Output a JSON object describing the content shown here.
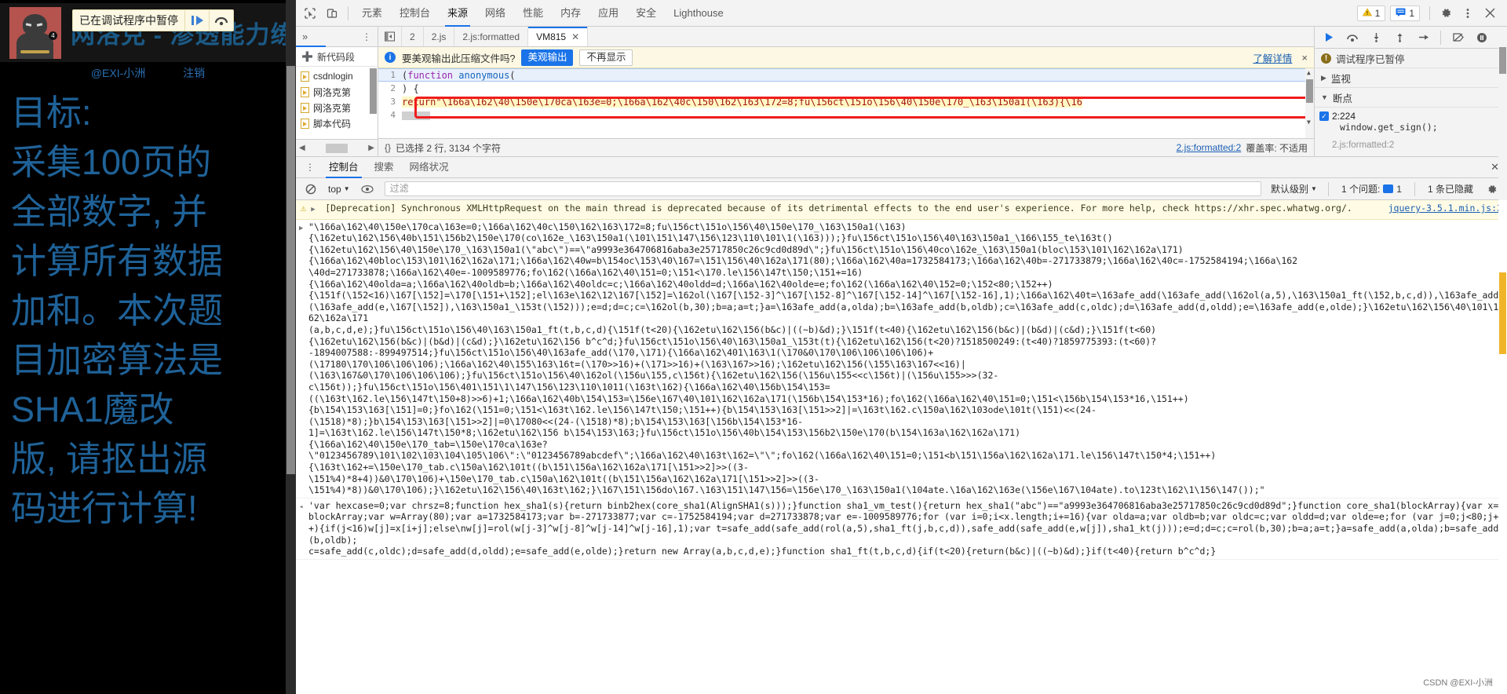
{
  "webpage": {
    "paused_banner": {
      "text": "已在调试程序中暂停",
      "resume_icon": "resume-icon",
      "step_icon": "step-over-icon"
    },
    "site_title": "网洛克 - 渗透能力练习平台",
    "avatar_badge": "4",
    "byline": "@EXI-小洲",
    "logout": "注销",
    "goal_lines": [
      "目标:",
      "采集100页的",
      "全部数字, 并",
      "计算所有数据",
      "加和。本次题",
      "目加密算法是",
      "SHA1魔改",
      "版, 请抠出源",
      "码进行计算!"
    ]
  },
  "devtools": {
    "toolbar": {
      "inspect_icon": "inspect-element-icon",
      "device_icon": "device-toolbar-icon",
      "tabs": [
        {
          "label": "元素",
          "active": false
        },
        {
          "label": "控制台",
          "active": false
        },
        {
          "label": "来源",
          "active": true
        },
        {
          "label": "网络",
          "active": false
        },
        {
          "label": "性能",
          "active": false
        },
        {
          "label": "内存",
          "active": false
        },
        {
          "label": "应用",
          "active": false
        },
        {
          "label": "安全",
          "active": false
        },
        {
          "label": "Lighthouse",
          "active": false
        }
      ],
      "warning_count": "1",
      "message_count": "1",
      "settings_icon": "gear-icon",
      "more_icon": "kebab-menu-icon",
      "close_icon": "close-icon"
    },
    "navigator": {
      "overflow_icon": "chevron-double-right-icon",
      "more_icon": "kebab-menu-icon",
      "new_snippet": "新代码段",
      "files": [
        "csdnlogin",
        "网洛克第",
        "网洛克第",
        "脚本代码"
      ]
    },
    "editor": {
      "sidebar_toggle_icon": "show-navigator-icon",
      "tabs": [
        {
          "label": "2",
          "active": false,
          "closable": false
        },
        {
          "label": "2.js",
          "active": false,
          "closable": false
        },
        {
          "label": "2.js:formatted",
          "active": false,
          "closable": false
        },
        {
          "label": "VM815",
          "active": true,
          "closable": true
        }
      ],
      "infobar": {
        "icon": "info-icon",
        "message": "要美观输出此压缩文件吗?",
        "primary_button": "美观输出",
        "secondary_button": "不再显示",
        "learn_more": "了解详情",
        "close": "×"
      },
      "code_lines": [
        {
          "num": "1",
          "text": "(function anonymous("
        },
        {
          "num": "2",
          "text": ") {"
        },
        {
          "num": "3",
          "text": "return\"\\166a\\162\\40\\150e\\170ca\\163e=0;\\166a\\162\\40c\\150\\162\\163\\172=8;fu\\156ct\\151o\\156\\40\\150e\\170_\\163\\150a1(\\163){\\16"
        },
        {
          "num": "4",
          "text": "}"
        }
      ],
      "status": {
        "braces_icon": "format-braces-icon",
        "selection": "已选择 2 行, 3134 个字符",
        "source_link": "2.js:formatted:2",
        "coverage": "覆盖率: 不适用"
      }
    },
    "debugger": {
      "controls": [
        "resume-icon",
        "step-over-icon",
        "step-into-icon",
        "step-out-icon",
        "step-icon",
        "deactivate-breakpoints-icon",
        "pause-on-exceptions-icon"
      ],
      "paused_title": "调试程序已暂停",
      "watch_label": "监视",
      "breakpoints_label": "断点",
      "breakpoints": [
        {
          "location": "2:224",
          "source": "window.get_sign();",
          "checked": true
        }
      ],
      "next_partial": "2.js:formatted:2"
    },
    "drawer": {
      "more_icon": "kebab-menu-icon",
      "tabs": [
        {
          "label": "控制台",
          "active": true
        },
        {
          "label": "搜索",
          "active": false
        },
        {
          "label": "网络状况",
          "active": false
        }
      ],
      "close_icon": "close-icon",
      "toolbar": {
        "clear_icon": "clear-console-icon",
        "context": "top",
        "eye_icon": "live-expression-icon",
        "filter_placeholder": "过滤",
        "level": "默认级别",
        "issues": "1 个问题:",
        "issue_count": "1",
        "hidden": "1 条已隐藏",
        "settings_icon": "gear-icon"
      },
      "messages": [
        {
          "type": "warning",
          "icon": "warning-triangle-icon",
          "text": "[Deprecation] Synchronous XMLHttpRequest on the main thread is deprecated because of its detrimental effects to the end user's experience. For more help, check https://xhr.spec.whatwg.org/.",
          "link": "https://xhr.spec.whatwg.org/",
          "source": "jquery-3.5.1.min.js:2"
        },
        {
          "type": "log",
          "arrow": "▶",
          "text": "\"\\166a\\162\\40\\150e\\170ca\\163e=0;\\166a\\162\\40c\\150\\162\\163\\172=8;fu\\156ct\\151o\\156\\40\\150e\\170_\\163\\150a1(\\163)\n{\\162etu\\162\\156\\40b\\151\\156b2\\150e\\170(co\\162e_\\163\\150a1(\\101\\151\\147\\156\\123\\110\\101\\1(\\163)));}fu\\156ct\\151o\\156\\40\\163\\150a1_\\166\\155_te\\163t()\n{\\162etu\\162\\156\\40\\150e\\170_\\163\\150a1(\\\"abc\\\")==\\\"a9993e364706816aba3e25717850c26c9cd0d89d\\\";}fu\\156ct\\151o\\156\\40co\\162e_\\163\\150a1(bloc\\153\\101\\162\\162a\\171)\n{\\166a\\162\\40bloc\\153\\101\\162\\162a\\171;\\166a\\162\\40w=b\\154oc\\153\\40\\167=\\151\\156\\40\\162a\\171(80);\\166a\\162\\40a=1732584173;\\166a\\162\\40b=-271733879;\\166a\\162\\40c=-1752584194;\\166a\\162\n\\40d=271733878;\\166a\\162\\40e=-1009589776;fo\\162(\\166a\\162\\40\\151=0;\\151<\\170.le\\156\\147t\\150;\\151+=16)\n{\\166a\\162\\40olda=a;\\166a\\162\\40oldb=b;\\166a\\162\\40oldc=c;\\166a\\162\\40oldd=d;\\166a\\162\\40olde=e;fo\\162(\\166a\\162\\40\\152=0;\\152<80;\\152++)\n{\\151f(\\152<16)\\167[\\152]=\\170[\\151+\\152];el\\163e\\162\\12\\167[\\152]=\\162ol(\\167[\\152-3]^\\167[\\152-8]^\\167[\\152-14]^\\167[\\152-16],1);\\166a\\162\\40t=\\163afe_add(\\163afe_add(\\162ol(a,5),\\163\\150a1_ft(\\152,b,c,d)),\\163afe_add(\\163afe_add(e,\\167[\\152]),\\163\\150a1_\\153t(\\152)));e=d;d=c;c=\\162ol(b,30);b=a;a=t;}a=\\163afe_add(a,olda);b=\\163afe_add(b,oldb);c=\\163afe_add(c,oldc);d=\\163afe_add(d,oldd);e=\\163afe_add(e,olde);}\\162etu\\162\\156\\40\\101\\162\\162a\\171\n(a,b,c,d,e);}fu\\156ct\\151o\\156\\40\\163\\150a1_ft(t,b,c,d){\\151f(t<20){\\162etu\\162\\156(b&c)|((~b)&d);}\\151f(t<40){\\162etu\\162\\156(b&c)|(b&d)|(c&d);}\\151f(t<60)\n{\\162etu\\162\\156(b&c)|(b&d)|(c&d);}\\162etu\\162\\156 b^c^d;}fu\\156ct\\151o\\156\\40\\163\\150a1_\\153t(t){\\162etu\\162\\156(t<20)?1518500249:(t<40)?1859775393:(t<60)?\n-1894007588:-899497514;}fu\\156ct\\151o\\156\\40\\163afe_add(\\170,\\171){\\166a\\162\\401\\163\\1(\\170&0\\170\\106\\106\\106\\106)+\n(\\17180\\170\\106\\106\\106);\\166a\\162\\40\\155\\163\\16t=(\\170>>16)+(\\171>>16)+(\\163\\167>>16);\\162etu\\162\\156(\\155\\163\\167<<16)|\n(\\163\\167&0\\170\\106\\106\\106);}fu\\156ct\\151o\\156\\40\\162ol(\\156u\\155,c\\156t){\\162etu\\162\\156(\\156u\\155<<c\\156t)|(\\156u\\155>>>(32-\nc\\156t));}fu\\156ct\\151o\\156\\401\\151\\1\\147\\156\\123\\110\\1011(\\163t\\162){\\166a\\162\\40\\156b\\154\\153=\n((\\163t\\162.le\\156\\147t\\150+8)>>6)+1;\\166a\\162\\40b\\154\\153=\\156e\\167\\40\\101\\162\\162a\\171(\\156b\\154\\153*16);fo\\162(\\166a\\162\\40\\151=0;\\151<\\156b\\154\\153*16,\\151++)\n{b\\154\\153\\163[\\151]=0;}fo\\162(\\151=0;\\151<\\163t\\162.le\\156\\147t\\150;\\151++){b\\154\\153\\163[\\151>>2]|=\\163t\\162.c\\150a\\162\\103ode\\101t(\\151)<<(24-\n(\\1518)*8);}b\\154\\153\\163[\\151>>2]|=0\\17080<<(24-(\\1518)*8);b\\154\\153\\163[\\156b\\154\\153*16-\n1]=\\163t\\162.le\\156\\147t\\150*8;\\162etu\\162\\156 b\\154\\153\\163;}fu\\156ct\\151o\\156\\40b\\154\\153\\156b2\\150e\\170(b\\154\\163a\\162\\162a\\171)\n{\\166a\\162\\40\\150e\\170_tab=\\150e\\170ca\\163e?\n\\\"0123456789\\101\\102\\103\\104\\105\\106\\\":\\\"0123456789abcdef\\\";\\166a\\162\\40\\163t\\162=\\\"\\\";fo\\162(\\166a\\162\\40\\151=0;\\151<b\\151\\156a\\162\\162a\\171.le\\156\\147t\\150*4;\\151++)\n{\\163t\\162+=\\150e\\170_tab.c\\150a\\162\\101t((b\\151\\156a\\162\\162a\\171[\\151>>2]>>((3-\n\\151%4)*8+4))&0\\170\\106)+\\150e\\170_tab.c\\150a\\162\\101t((b\\151\\156a\\162\\162a\\171[\\151>>2]>>((3-\n\\151%4)*8))&0\\170\\106);}\\162etu\\162\\156\\40\\163t\\162;}\\167\\151\\156do\\167.\\163\\151\\147\\156=\\156e\\170_\\163\\150a1(\\104ate.\\16a\\162\\163e(\\156e\\167\\104ate).to\\123t\\162\\1\\156\\147());\"",
          "collapsed": true
        },
        {
          "type": "log",
          "arrow": "◂",
          "text": "'var hexcase=0;var chrsz=8;function hex_sha1(s){return binb2hex(core_sha1(AlignSHA1(s)));}function sha1_vm_test(){return hex_sha1(\"abc\")==\"a9993e364706816aba3e25717850c26c9cd0d89d\";}function core_sha1(blockArray){var x=blockArray;var w=Array(80);var a=1732584173;var b=-271733877;var c=-1752584194;var d=271733878;var e=-1009589776;for (var i=0;i<x.length;i+=16){var olda=a;var oldb=b;var oldc=c;var oldd=d;var olde=e;for (var j=0;j<80;j++){if(j<16)w[j]=x[i+j];else\\nw[j]=rol(w[j-3]^w[j-8]^w[j-14]^w[j-16],1);var t=safe_add(safe_add(rol(a,5),sha1_ft(j,b,c,d)),safe_add(safe_add(e,w[j]),sha1_kt(j)));e=d;d=c;c=rol(b,30);b=a;a=t;}a=safe_add(a,olda);b=safe_add(b,oldb);\nc=safe_add(c,oldc);d=safe_add(d,oldd);e=safe_add(e,olde);}return new Array(a,b,c,d,e);}function sha1_ft(t,b,c,d){if(t<20){return(b&c)|((~b)&d);}if(t<40){return b^c^d;}",
          "collapsed": false
        }
      ],
      "watermark": "CSDN @EXI-小洲"
    }
  }
}
